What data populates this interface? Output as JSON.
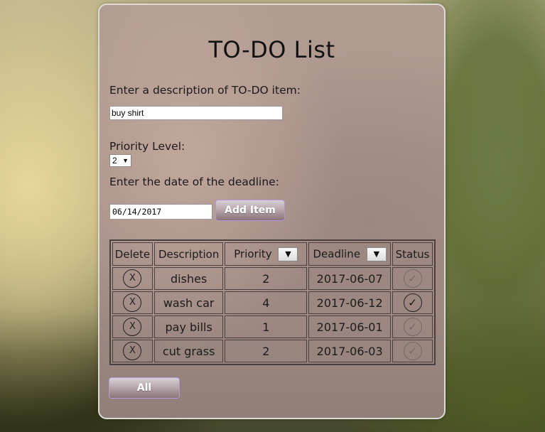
{
  "title": "TO-DO List",
  "form": {
    "description_label": "Enter a description of TO-DO item:",
    "description_value": "buy shirt",
    "priority_label": "Priority Level:",
    "priority_value": "2",
    "deadline_label": "Enter the date of the deadline:",
    "deadline_value": "06/14/2017",
    "add_button": "Add Item"
  },
  "table": {
    "headers": {
      "delete": "Delete",
      "description": "Description",
      "priority": "Priority",
      "deadline": "Deadline",
      "status": "Status"
    },
    "sort_icon": "▼",
    "delete_symbol": "X",
    "check_symbol": "✓",
    "rows": [
      {
        "description": "dishes",
        "priority": "2",
        "deadline": "2017-06-07",
        "done": false
      },
      {
        "description": "wash car",
        "priority": "4",
        "deadline": "2017-06-12",
        "done": true
      },
      {
        "description": "pay bills",
        "priority": "1",
        "deadline": "2017-06-01",
        "done": false
      },
      {
        "description": "cut grass",
        "priority": "2",
        "deadline": "2017-06-03",
        "done": false
      }
    ]
  },
  "filter_button": "All"
}
